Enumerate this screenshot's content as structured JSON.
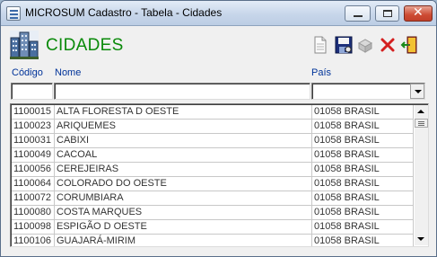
{
  "window": {
    "title": "MICROSUM Cadastro - Tabela - Cidades",
    "close_glyph": "✕"
  },
  "header": {
    "title": "CIDADES"
  },
  "toolbar": {
    "icons": [
      "new-document-icon",
      "save-icon",
      "print-icon",
      "delete-icon",
      "exit-icon"
    ]
  },
  "columns": {
    "code": "Código",
    "name": "Nome",
    "country": "País"
  },
  "filters": {
    "code_value": "",
    "name_value": "",
    "country_value": ""
  },
  "rows": [
    {
      "code": "1100015",
      "name": "ALTA FLORESTA D OESTE",
      "country": "01058 BRASIL"
    },
    {
      "code": "1100023",
      "name": "ARIQUEMES",
      "country": "01058 BRASIL"
    },
    {
      "code": "1100031",
      "name": "CABIXI",
      "country": "01058 BRASIL"
    },
    {
      "code": "1100049",
      "name": "CACOAL",
      "country": "01058 BRASIL"
    },
    {
      "code": "1100056",
      "name": "CEREJEIRAS",
      "country": "01058 BRASIL"
    },
    {
      "code": "1100064",
      "name": "COLORADO DO OESTE",
      "country": "01058 BRASIL"
    },
    {
      "code": "1100072",
      "name": "CORUMBIARA",
      "country": "01058 BRASIL"
    },
    {
      "code": "1100080",
      "name": "COSTA MARQUES",
      "country": "01058 BRASIL"
    },
    {
      "code": "1100098",
      "name": "ESPIGÃO D OESTE",
      "country": "01058 BRASIL"
    },
    {
      "code": "1100106",
      "name": "GUAJARÁ-MIRIM",
      "country": "01058 BRASIL"
    }
  ],
  "colors": {
    "header_title": "#0a8a0a",
    "label": "#003399",
    "delete": "#d42020"
  }
}
